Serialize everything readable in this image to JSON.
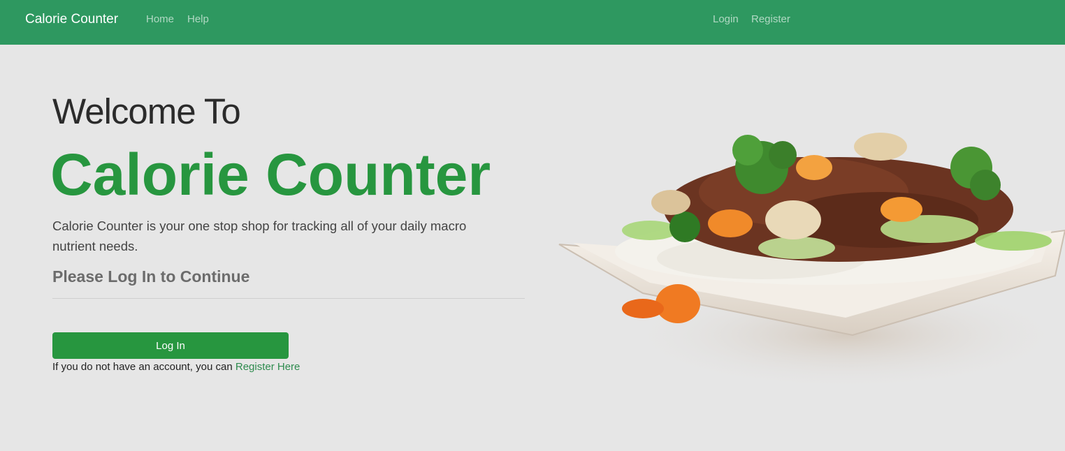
{
  "navbar": {
    "brand": "Calorie Counter",
    "links": [
      {
        "label": "Home"
      },
      {
        "label": "Help"
      }
    ],
    "right_links": [
      {
        "label": "Login"
      },
      {
        "label": "Register"
      }
    ]
  },
  "hero": {
    "welcome": "Welcome To",
    "title": "Calorie Counter",
    "lead": "Calorie Counter is your one stop shop for tracking all of your daily macro nutrient needs.",
    "subhead": "Please Log In to Continue",
    "login_button": "Log In",
    "register_prefix": "If you do not have an account, you can ",
    "register_link": "Register Here"
  },
  "colors": {
    "navbar": "#2e9860",
    "accent": "#27963f",
    "background": "#e6e6e6"
  },
  "image": {
    "icon": "food-plate-image"
  }
}
